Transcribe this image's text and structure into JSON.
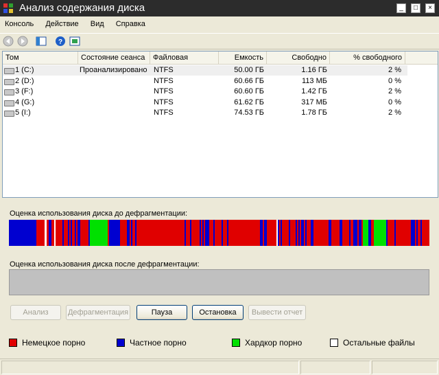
{
  "window": {
    "title": "Анализ содержания диска"
  },
  "menu": [
    "Консоль",
    "Действие",
    "Вид",
    "Справка"
  ],
  "columns": [
    "Том",
    "Состояние сеанса",
    "Файловая система",
    "Емкость",
    "Свободно",
    "% свободного места"
  ],
  "volumes": [
    {
      "name": "1 (C:)",
      "status": "Проанализировано",
      "fs": "NTFS",
      "capacity": "50.00 ГБ",
      "free": "1.16 ГБ",
      "pct": "2 %"
    },
    {
      "name": "2 (D:)",
      "status": "",
      "fs": "NTFS",
      "capacity": "60.66 ГБ",
      "free": "113 МБ",
      "pct": "0 %"
    },
    {
      "name": "3 (F:)",
      "status": "",
      "fs": "NTFS",
      "capacity": "60.60 ГБ",
      "free": "1.42 ГБ",
      "pct": "2 %"
    },
    {
      "name": "4 (G:)",
      "status": "",
      "fs": "NTFS",
      "capacity": "61.62 ГБ",
      "free": "317 МБ",
      "pct": "0 %"
    },
    {
      "name": "5 (I:)",
      "status": "",
      "fs": "NTFS",
      "capacity": "74.53 ГБ",
      "free": "1.78 ГБ",
      "pct": "2 %"
    }
  ],
  "analysis": {
    "before_label": "Оценка использования диска до дефрагментации:",
    "after_label": "Оценка использования диска после дефрагментации:"
  },
  "buttons": {
    "analyze": "Анализ",
    "defrag": "Дефрагментация",
    "pause": "Пауза",
    "stop": "Остановка",
    "report": "Вывести отчет"
  },
  "legend": [
    {
      "label": "Немецкое порно",
      "color": "#e00000"
    },
    {
      "label": "Частное порно",
      "color": "#0000d0"
    },
    {
      "label": "Хардкор порно",
      "color": "#00e000"
    },
    {
      "label": "Остальные файлы",
      "color": "#ffffff"
    }
  ],
  "colors": {
    "fragmented": "#e00000",
    "contiguous": "#0000d0",
    "system": "#00e000",
    "free": "#ffffff"
  }
}
